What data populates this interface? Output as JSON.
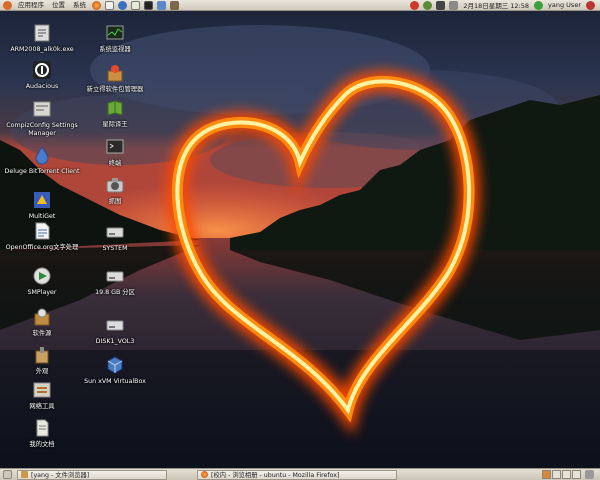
{
  "top_panel": {
    "menus": [
      "应用程序",
      "位置",
      "系统"
    ],
    "clock": "2月18日星期三 12:58",
    "user": "yang User"
  },
  "desktop": {
    "icons": [
      {
        "label": "ARM2008_alk0k.exe",
        "icon": "exe-file-icon"
      },
      {
        "label": "Audacious",
        "icon": "audacious-icon"
      },
      {
        "label": "CompizConfig Settings Manager",
        "icon": "compiz-icon"
      },
      {
        "label": "Deluge BitTorrent Client",
        "icon": "deluge-icon"
      },
      {
        "label": "MultiGet",
        "icon": "multiget-icon"
      },
      {
        "label": "OpenOffice.org文字处理",
        "icon": "openoffice-writer-icon"
      },
      {
        "label": "SMPlayer",
        "icon": "smplayer-icon"
      },
      {
        "label": "软件源",
        "icon": "software-sources-icon"
      },
      {
        "label": "外观",
        "icon": "appearance-icon"
      },
      {
        "label": "网络工具",
        "icon": "network-tools-icon"
      },
      {
        "label": "我的文档",
        "icon": "my-documents-icon"
      },
      {
        "label": "系统监视器",
        "icon": "system-monitor-icon"
      },
      {
        "label": "新立得软件包管理器",
        "icon": "synaptic-icon"
      },
      {
        "label": "星际译王",
        "icon": "stardict-icon"
      },
      {
        "label": "终端",
        "icon": "terminal-icon"
      },
      {
        "label": "抓图",
        "icon": "screenshot-icon"
      },
      {
        "label": "SYSTEM",
        "icon": "drive-icon"
      },
      {
        "label": "19.8 GB 分区",
        "icon": "drive-icon"
      },
      {
        "label": "DISK1_VOL3",
        "icon": "drive-icon"
      },
      {
        "label": "Sun xVM VirtualBox",
        "icon": "virtualbox-icon"
      }
    ]
  },
  "taskbar": {
    "tasks": [
      "[yang - 文件浏览器]",
      "[校内 - 浏览相册 - ubuntu - Mozilla Firefox]"
    ]
  },
  "colors": {
    "panel": "#d9d4c8",
    "heart_fire": "#ff7a00",
    "heart_core": "#fff3a0"
  }
}
